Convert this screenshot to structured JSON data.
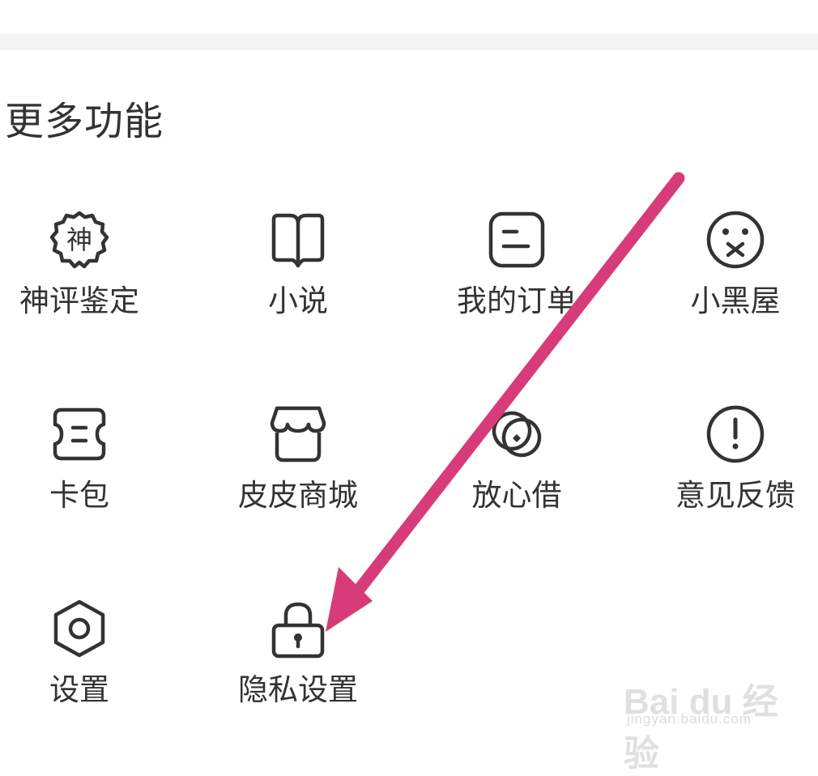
{
  "section": {
    "title": "更多功能"
  },
  "items": [
    {
      "label": "神评鉴定",
      "icon": "shen-badge-icon",
      "badge_char": "神"
    },
    {
      "label": "小说",
      "icon": "book-icon"
    },
    {
      "label": "我的订单",
      "icon": "order-icon"
    },
    {
      "label": "小黑屋",
      "icon": "muted-face-icon"
    },
    {
      "label": "卡包",
      "icon": "ticket-icon"
    },
    {
      "label": "皮皮商城",
      "icon": "shop-icon"
    },
    {
      "label": "放心借",
      "icon": "coin-icon"
    },
    {
      "label": "意见反馈",
      "icon": "exclamation-icon"
    },
    {
      "label": "设置",
      "icon": "gear-icon"
    },
    {
      "label": "隐私设置",
      "icon": "lock-icon"
    }
  ],
  "annotation": {
    "arrow_color": "#d83c78",
    "icon_color": "#333333"
  },
  "watermark": {
    "logo": "Bai du 经验",
    "url": "jingyan.baidu.com"
  }
}
